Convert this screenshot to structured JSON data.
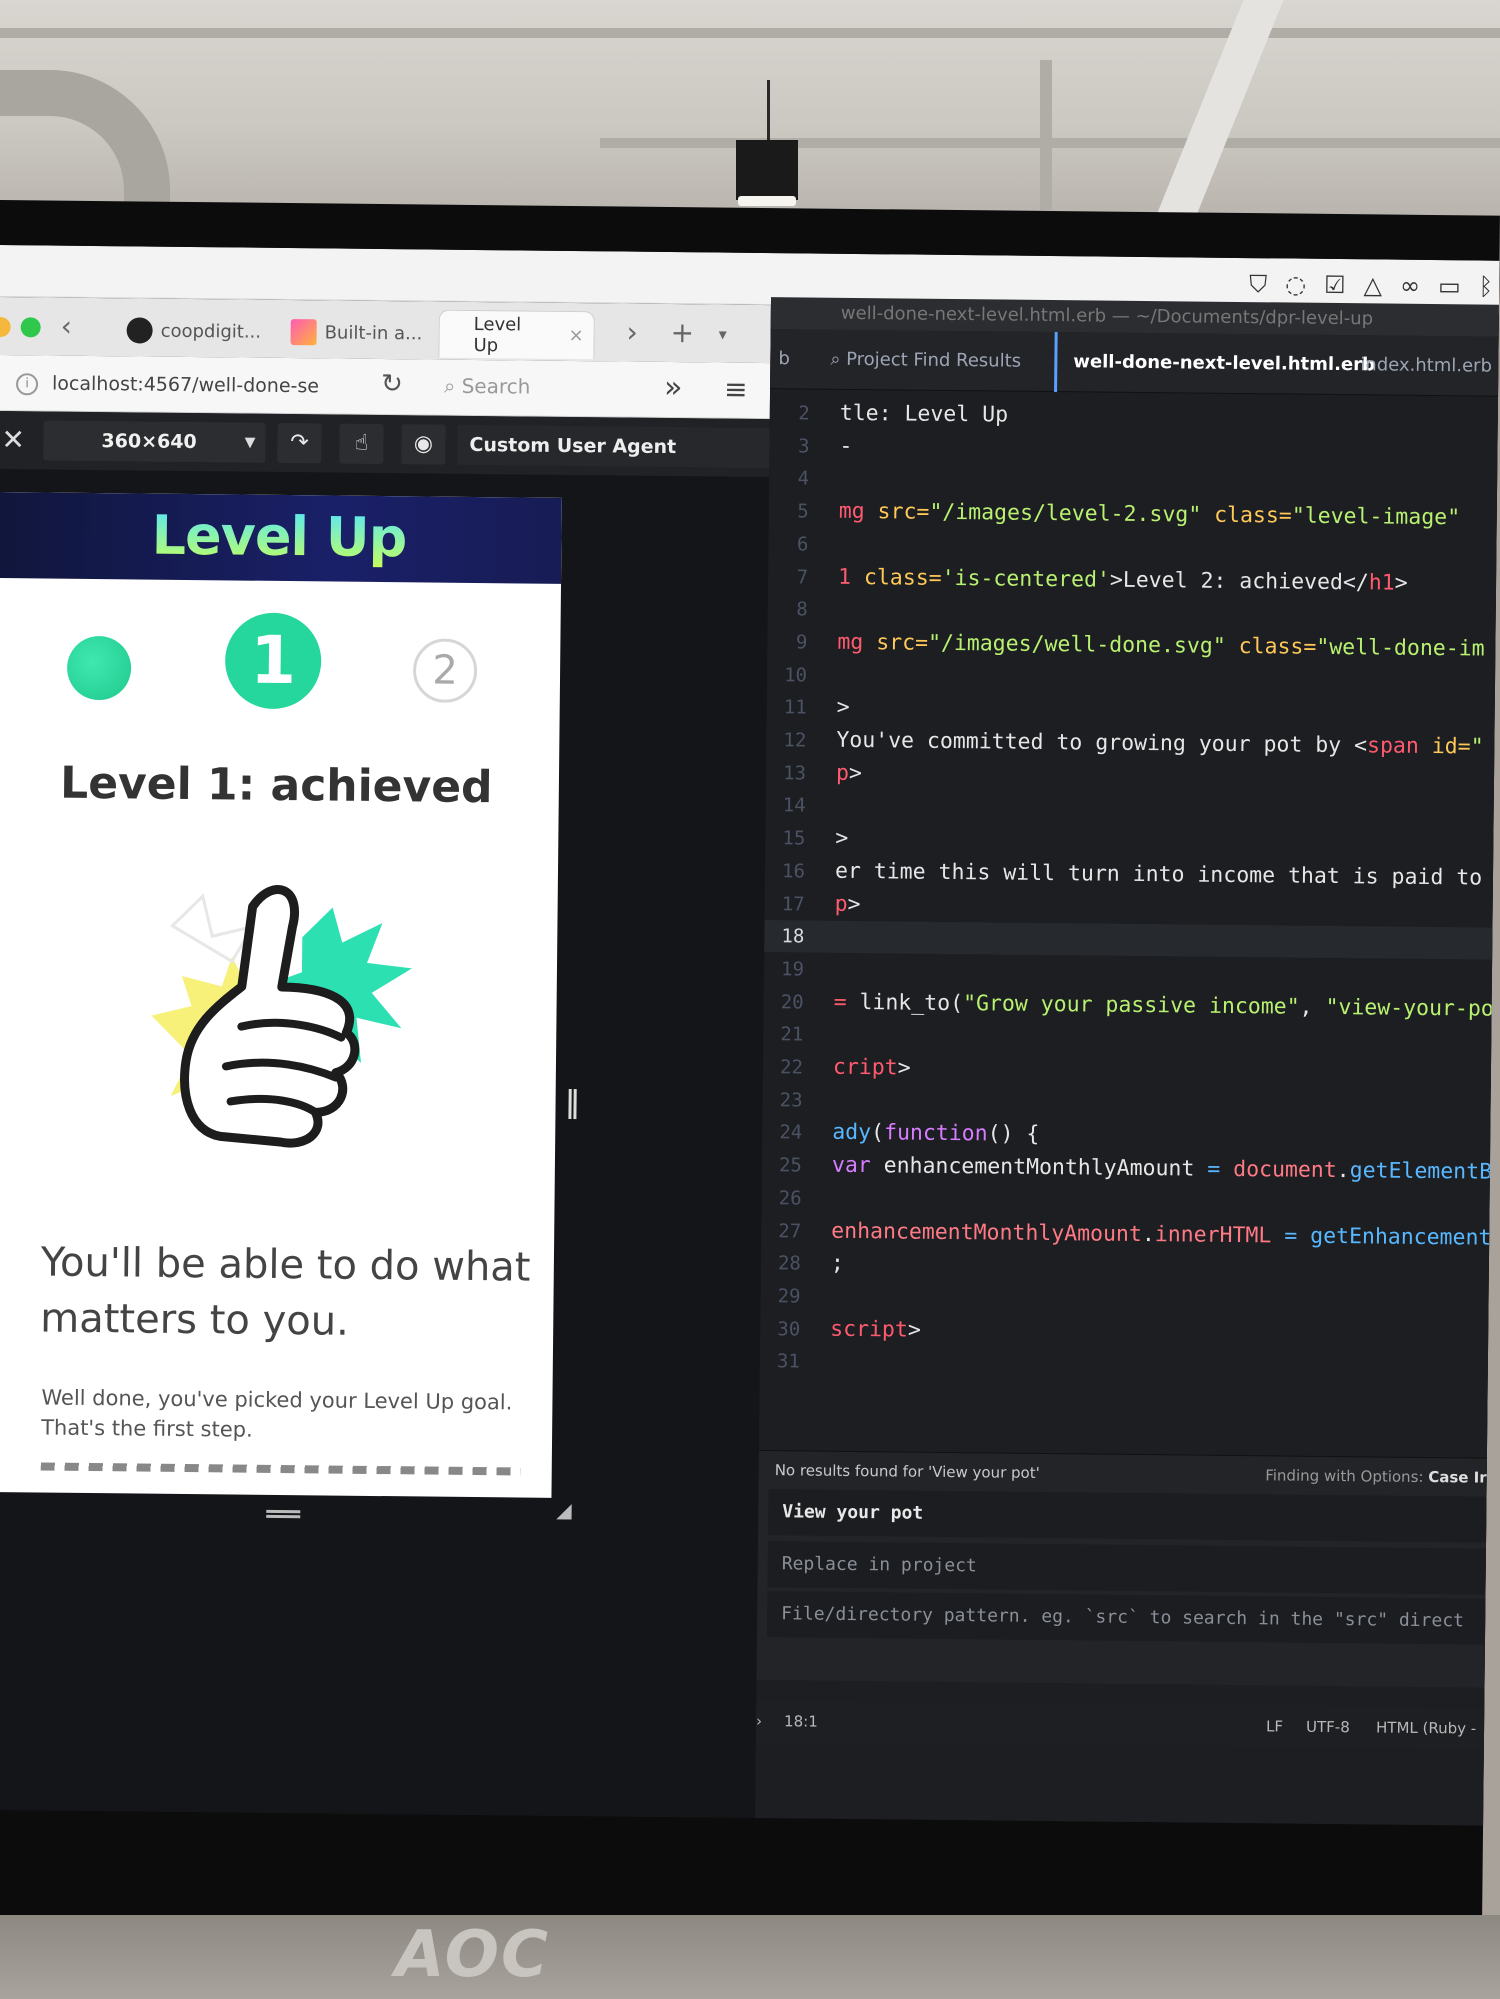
{
  "browser": {
    "tabs": [
      {
        "label": "coopdigit..."
      },
      {
        "label": "Built-in a..."
      },
      {
        "label": "Level Up"
      }
    ],
    "url": "localhost:4567/well-done-se",
    "search_placeholder": "Search",
    "rdm": {
      "device_size": "360×640",
      "user_agent": "Custom User Agent"
    }
  },
  "page": {
    "logo": "Level Up",
    "steps": [
      "1",
      "2"
    ],
    "heading": "Level 1: achieved",
    "lead": "You'll be able to do what matters to you.",
    "body": "Well done, you've picked your Level Up goal. That's the first step."
  },
  "editor": {
    "window_title": "well-done-next-level.html.erb — ~/Documents/dpr-level-up",
    "tabs": [
      "Project Find Results",
      "well-done-next-level.html.erb",
      "index.html.erb"
    ],
    "tab_prefix": "b",
    "code": [
      {
        "n": "2",
        "segs": [
          [
            "plain",
            "tle: Level Up"
          ]
        ]
      },
      {
        "n": "3",
        "segs": [
          [
            "plain",
            "-"
          ]
        ]
      },
      {
        "n": "4",
        "segs": []
      },
      {
        "n": "5",
        "segs": [
          [
            "tag",
            "mg "
          ],
          [
            "attr",
            "src="
          ],
          [
            "str",
            "\"/images/level-2.svg\""
          ],
          [
            "attr",
            " class="
          ],
          [
            "str",
            "\"level-image\""
          ]
        ]
      },
      {
        "n": "6",
        "segs": []
      },
      {
        "n": "7",
        "segs": [
          [
            "tag",
            "1 "
          ],
          [
            "attr",
            "class="
          ],
          [
            "str",
            "'is-centered'"
          ],
          [
            "plain",
            ">Level 2: achieved</"
          ],
          [
            "tag",
            "h1"
          ],
          [
            "plain",
            ">"
          ]
        ]
      },
      {
        "n": "8",
        "segs": []
      },
      {
        "n": "9",
        "segs": [
          [
            "tag",
            "mg "
          ],
          [
            "attr",
            "src="
          ],
          [
            "str",
            "\"/images/well-done.svg\""
          ],
          [
            "attr",
            " class="
          ],
          [
            "str",
            "\"well-done-im"
          ]
        ]
      },
      {
        "n": "10",
        "segs": []
      },
      {
        "n": "11",
        "segs": [
          [
            "plain",
            ">"
          ]
        ]
      },
      {
        "n": "12",
        "segs": [
          [
            "plain",
            "You've committed to growing your pot by <"
          ],
          [
            "tag",
            "span "
          ],
          [
            "attr",
            "id="
          ],
          [
            "str",
            "\""
          ]
        ]
      },
      {
        "n": "13",
        "segs": [
          [
            "tag",
            "p"
          ],
          [
            "plain",
            ">"
          ]
        ]
      },
      {
        "n": "14",
        "segs": []
      },
      {
        "n": "15",
        "segs": [
          [
            "plain",
            ">"
          ]
        ]
      },
      {
        "n": "16",
        "segs": [
          [
            "plain",
            "er time this will turn into income that is paid to"
          ]
        ]
      },
      {
        "n": "17",
        "segs": [
          [
            "tag",
            "p"
          ],
          [
            "plain",
            ">"
          ]
        ]
      },
      {
        "n": "18",
        "segs": [],
        "current": true
      },
      {
        "n": "19",
        "segs": []
      },
      {
        "n": "20",
        "segs": [
          [
            "tag",
            "= "
          ],
          [
            "plain",
            "link_to("
          ],
          [
            "str",
            "\"Grow your passive income\""
          ],
          [
            "plain",
            ", "
          ],
          [
            "str",
            "\"view-your-po"
          ]
        ]
      },
      {
        "n": "21",
        "segs": []
      },
      {
        "n": "22",
        "segs": [
          [
            "tag",
            "cript"
          ],
          [
            "plain",
            ">"
          ]
        ]
      },
      {
        "n": "23",
        "segs": []
      },
      {
        "n": "24",
        "segs": [
          [
            "fn",
            "ady"
          ],
          [
            "plain",
            "("
          ],
          [
            "kw",
            "function"
          ],
          [
            "plain",
            "() {"
          ]
        ]
      },
      {
        "n": "25",
        "segs": [
          [
            "kw",
            "var "
          ],
          [
            "plain",
            "enhancementMonthlyAmount "
          ],
          [
            "fn",
            "= "
          ],
          [
            "var",
            "document"
          ],
          [
            "plain",
            "."
          ],
          [
            "fn",
            "getElementBy"
          ]
        ]
      },
      {
        "n": "26",
        "segs": []
      },
      {
        "n": "27",
        "segs": [
          [
            "var",
            "enhancementMonthlyAmount"
          ],
          [
            "plain",
            "."
          ],
          [
            "var",
            "innerHTML"
          ],
          [
            "fn",
            " = "
          ],
          [
            "fn",
            "getEnhancementF"
          ]
        ]
      },
      {
        "n": "28",
        "segs": [
          [
            "plain",
            ";"
          ]
        ]
      },
      {
        "n": "29",
        "segs": []
      },
      {
        "n": "30",
        "segs": [
          [
            "tag",
            "script"
          ],
          [
            "plain",
            ">"
          ]
        ]
      },
      {
        "n": "31",
        "segs": []
      }
    ],
    "find": {
      "status": "No results found for 'View your pot'",
      "options_label": "Finding with Options:",
      "options_value": "Case Ir",
      "query": "View your pot",
      "replace_placeholder": "Replace in project",
      "pattern_placeholder": "File/directory pattern. eg. `src` to search in the \"src\" direct"
    },
    "status": {
      "cursor": "18:1",
      "line_ending": "LF",
      "encoding": "UTF-8",
      "grammar": "HTML (Ruby -"
    }
  },
  "monitor": {
    "brand": "AOC"
  },
  "colors": {
    "accent": "#25d79c",
    "header": "#1a2068",
    "editor_bg": "#1c1e22"
  }
}
